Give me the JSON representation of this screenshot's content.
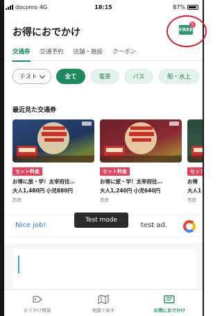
{
  "statusbar": {
    "carrier": "docomo",
    "network": "4G",
    "time": "18:15",
    "battery": "87%"
  },
  "header": {
    "title": "お得におでかけ",
    "ticket_icon_text": "FREE",
    "badge_count": "5"
  },
  "tabs": [
    {
      "label": "交通券",
      "active": true
    },
    {
      "label": "交通予約",
      "active": false
    },
    {
      "label": "店舗・施設",
      "active": false
    },
    {
      "label": "クーポン",
      "active": false
    }
  ],
  "filters": {
    "dropdown_label": "テスト",
    "chips": [
      "全て",
      "電車",
      "バス",
      "船・水上"
    ]
  },
  "recent": {
    "title": "最近見た交通券",
    "cards": [
      {
        "tag": "セット料金",
        "title": "お得に旅・学！太宰府往…",
        "price": "大人1,480円 小児880円",
        "operator": "西鉄"
      },
      {
        "tag": "セット料金",
        "title": "お得に旅・学！太宰府往…",
        "price": "大人1,240円 小児640円",
        "operator": "西鉄"
      },
      {
        "tag": "セット",
        "title": "お得",
        "price": "大人1",
        "operator": "西鉄"
      }
    ]
  },
  "ad": {
    "lead": "Nice job!",
    "trail": "test ad.",
    "toast": "Test mode"
  },
  "bottomnav": [
    {
      "label": "おでかけ情報",
      "icon": "tag-icon",
      "active": false
    },
    {
      "label": "地図で探す",
      "icon": "map-icon",
      "active": false
    },
    {
      "label": "お得におでかけ",
      "icon": "ticket-icon",
      "active": true
    }
  ]
}
